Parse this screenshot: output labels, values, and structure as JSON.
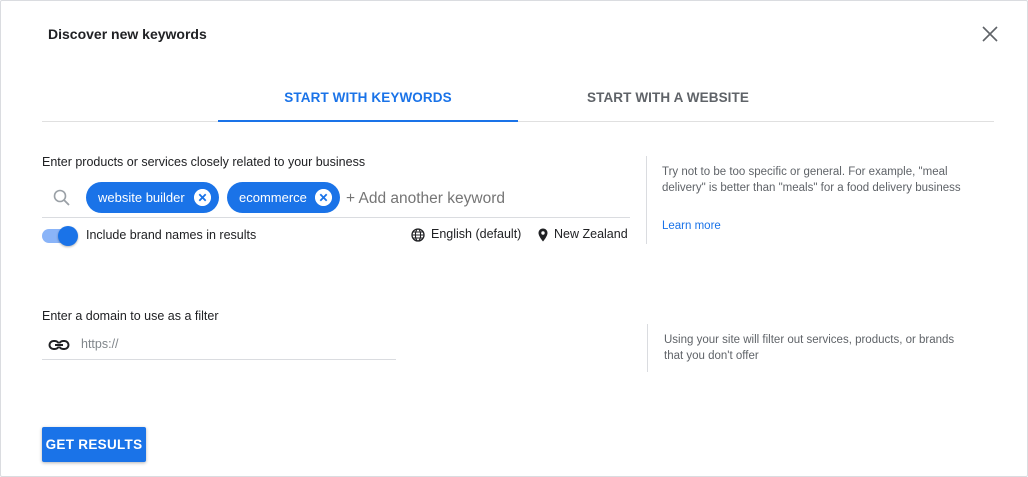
{
  "dialog": {
    "title": "Discover new keywords"
  },
  "tabs": [
    {
      "label": "START WITH KEYWORDS",
      "active": true
    },
    {
      "label": "START WITH A WEBSITE",
      "active": false
    }
  ],
  "keywords_section": {
    "label": "Enter products or services closely related to your business",
    "chips": [
      "website builder",
      "ecommerce"
    ],
    "add_placeholder": "+ Add another keyword",
    "brand_toggle_label": "Include brand names in results",
    "brand_toggle_on": true,
    "language": "English (default)",
    "location": "New Zealand",
    "help_text": "Try not to be too specific or general. For example, \"meal delivery\" is better than \"meals\" for a food delivery business",
    "learn_more": "Learn more"
  },
  "domain_section": {
    "label": "Enter a domain to use as a filter",
    "url_placeholder": "https://",
    "help_text": "Using your site will filter out services, products, or brands that you don't offer"
  },
  "actions": {
    "get_results": "GET RESULTS"
  },
  "colors": {
    "accent": "#1a73e8",
    "toggle_track": "#8ab4f8",
    "muted_text": "#5f6368"
  }
}
